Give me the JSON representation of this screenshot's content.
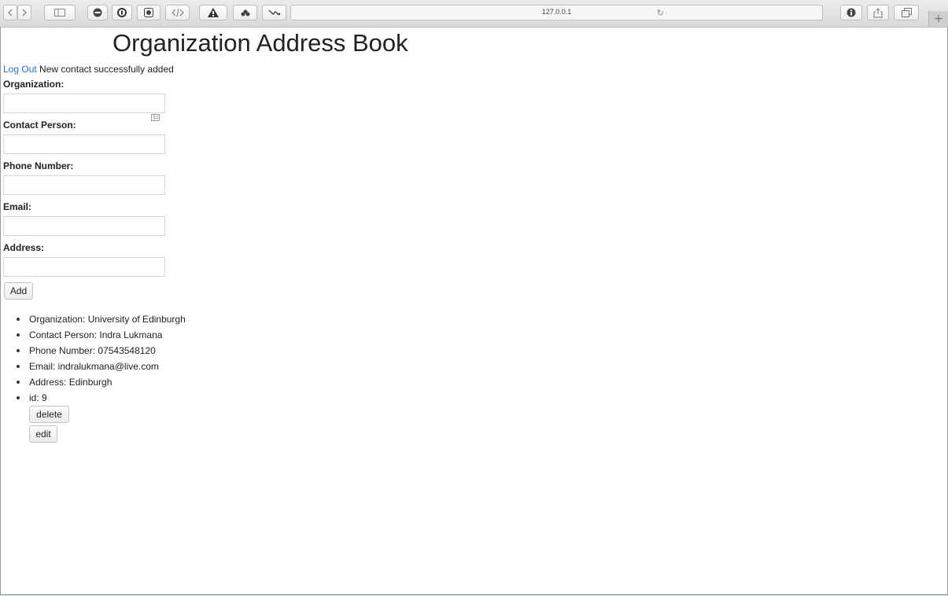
{
  "browser": {
    "url": "127.0.0.1"
  },
  "page": {
    "title": "Organization Address Book",
    "logout_link": "Log Out",
    "status_message": "New contact successfully added"
  },
  "form": {
    "organization_label": "Organization:",
    "contact_person_label": "Contact Person:",
    "phone_label": "Phone Number:",
    "email_label": "Email:",
    "address_label": "Address:",
    "organization_value": "",
    "contact_person_value": "",
    "phone_value": "",
    "email_value": "",
    "address_value": "",
    "add_button": "Add"
  },
  "contacts": [
    {
      "organization": "Organization: University of Edinburgh",
      "contact_person": "Contact Person: Indra Lukmana",
      "phone": "Phone Number: 07543548120",
      "email": "Email: indralukmana@live.com",
      "address": "Address: Edinburgh",
      "id": "id: 9",
      "delete_button": "delete",
      "edit_button": "edit"
    }
  ],
  "colors": {
    "link": "#2a6fd6",
    "frame_border_bottom": "#5a79a8"
  },
  "icons": {
    "back": "chevron-left-icon",
    "forward": "chevron-right-icon",
    "sidebar": "sidebar-icon",
    "reload": "reload-icon",
    "share": "share-icon",
    "tabs": "tabs-icon",
    "new_tab": "plus-icon",
    "autofill": "contact-card-icon"
  }
}
